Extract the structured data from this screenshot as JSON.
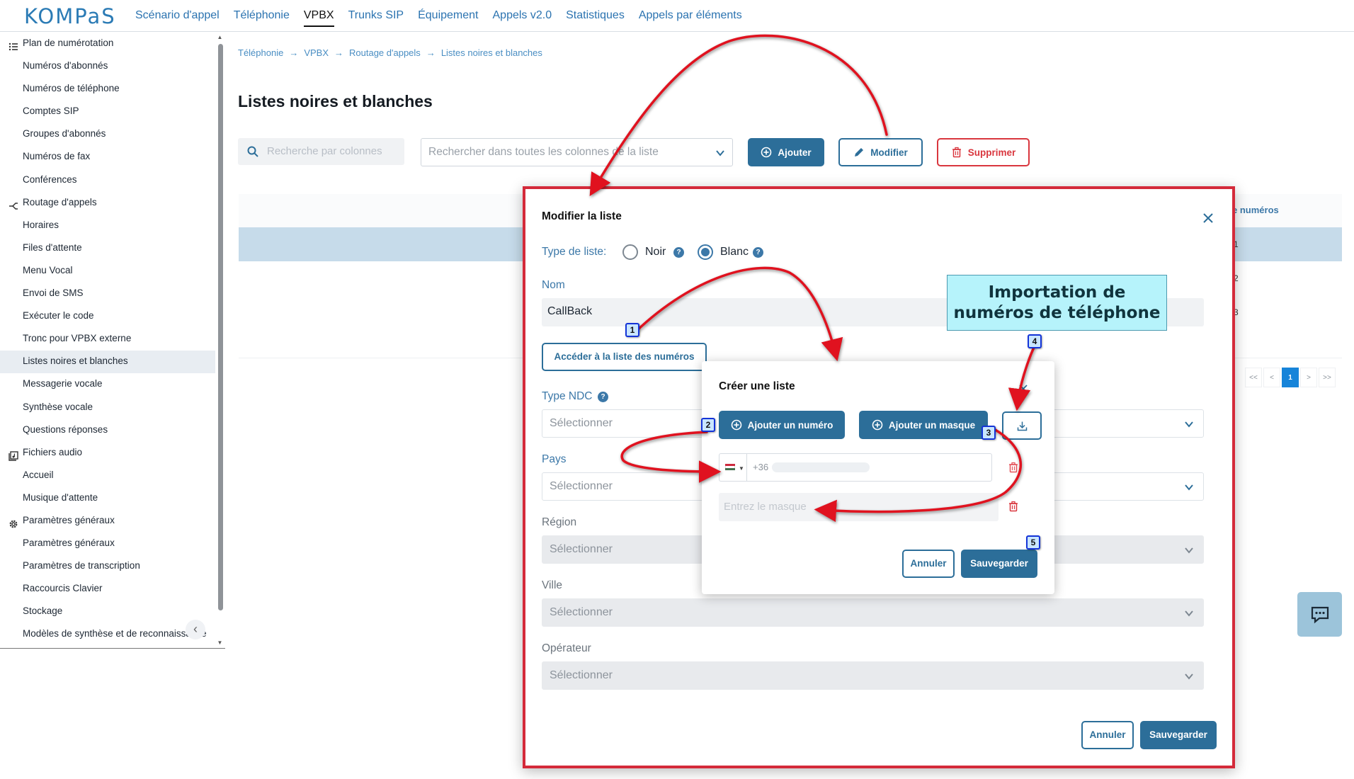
{
  "logo": "KOMPaS",
  "nav": {
    "items": [
      "Scénario d'appel",
      "Téléphonie",
      "VPBX",
      "Trunks SIP",
      "Équipement",
      "Appels v2.0",
      "Statistiques",
      "Appels par éléments"
    ],
    "active": "VPBX"
  },
  "sidebar": {
    "items": [
      {
        "label": "Plan de numérotation",
        "icon": "list-icon",
        "section": true
      },
      {
        "label": "Numéros d'abonnés"
      },
      {
        "label": "Numéros de téléphone"
      },
      {
        "label": "Comptes SIP"
      },
      {
        "label": "Groupes d'abonnés"
      },
      {
        "label": "Numéros de fax"
      },
      {
        "label": "Conférences"
      },
      {
        "label": "Routage d'appels",
        "icon": "routing-icon",
        "section": true
      },
      {
        "label": "Horaires"
      },
      {
        "label": "Files d'attente"
      },
      {
        "label": "Menu Vocal"
      },
      {
        "label": "Envoi de SMS"
      },
      {
        "label": "Exécuter le code"
      },
      {
        "label": "Tronc pour VPBX externe"
      },
      {
        "label": "Listes noires et blanches",
        "selected": true
      },
      {
        "label": "Messagerie vocale"
      },
      {
        "label": "Synthèse vocale"
      },
      {
        "label": "Questions réponses"
      },
      {
        "label": "Fichiers audio",
        "icon": "audio-files-icon",
        "section": true
      },
      {
        "label": "Accueil"
      },
      {
        "label": "Musique d'attente"
      },
      {
        "label": "Paramètres généraux",
        "icon": "gear-icon",
        "section": true
      },
      {
        "label": "Paramètres généraux"
      },
      {
        "label": "Paramètres de transcription"
      },
      {
        "label": "Raccourcis Clavier"
      },
      {
        "label": "Stockage"
      },
      {
        "label": "Modèles de synthèse et de reconnaissance"
      }
    ]
  },
  "breadcrumb": [
    "Téléphonie",
    "VPBX",
    "Routage d'appels",
    "Listes noires et blanches"
  ],
  "page": {
    "title": "Listes noires et blanches",
    "search_columns_placeholder": "Recherche par colonnes",
    "search_all_placeholder": "Rechercher dans toutes les colonnes de la liste",
    "add_label": "Ajouter",
    "edit_label": "Modifier",
    "delete_label": "Supprimer"
  },
  "table": {
    "column_partial": "e numéros",
    "row_values": [
      "1",
      "2",
      "3"
    ]
  },
  "pagination": [
    "<<",
    "<",
    "1",
    ">",
    ">>"
  ],
  "pagination_active": "1",
  "edit_modal": {
    "title": "Modifier la liste",
    "list_type_label": "Type de liste:",
    "option_black": "Noir",
    "option_white": "Blanc",
    "selected_type": "Blanc",
    "name_label": "Nom",
    "name_value": "CallBack",
    "access_button": "Accéder à la liste des numéros",
    "ndc_label": "Type NDC",
    "country_label": "Pays",
    "region_label": "Région",
    "city_label": "Ville",
    "operator_label": "Opérateur",
    "select_placeholder": "Sélectionner",
    "cancel": "Annuler",
    "save": "Sauvegarder"
  },
  "create_modal": {
    "title": "Créer une liste",
    "add_number": "Ajouter un numéro",
    "add_mask": "Ajouter un masque",
    "phone_code": "+36",
    "mask_placeholder": "Entrez le masque",
    "cancel": "Annuler",
    "save": "Sauvegarder"
  },
  "annotation": {
    "callout": "Importation de numéros de téléphone",
    "steps": [
      "1",
      "2",
      "3",
      "4",
      "5"
    ]
  },
  "colors": {
    "accent": "#2c6e99",
    "link": "#2b73b0",
    "danger": "#d9363e",
    "annotation_red": "#e0121f",
    "selected_row": "#c6dbea"
  }
}
